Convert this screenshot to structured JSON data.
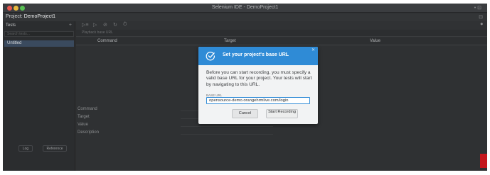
{
  "window": {
    "title": "Selenium IDE - DemoProject1",
    "right_controls": "• ⊡"
  },
  "project": {
    "label": "Project:",
    "name": "DemoProject1",
    "icons": "⊡"
  },
  "sidebar": {
    "header": "Tests",
    "add_icon": "+",
    "search_placeholder": "Search tests...",
    "items": [
      {
        "label": "Untitled"
      }
    ],
    "footer_buttons": [
      "Log",
      "Reference"
    ]
  },
  "toolbar": {
    "tools": [
      "▷≡",
      "▷",
      "⊘",
      "↻",
      "⏱"
    ],
    "record_icon": "⏺"
  },
  "url_bar": {
    "placeholder": "Playback base URL"
  },
  "table": {
    "columns": [
      "Command",
      "Target",
      "Value"
    ]
  },
  "command_editor": {
    "labels": [
      "Command",
      "Target",
      "Value",
      "Description"
    ]
  },
  "dialog": {
    "title": "Set your project's base URL",
    "close_icon": "✕",
    "body": "Before you can start recording, you must specify a valid base URL for your project. Your tests will start by navigating to this URL.",
    "field_label": "BASE URL",
    "base_url": "opensource-demo.orangehrmlive.com/login",
    "cancel_label": "Cancel",
    "start_label": "Start Recording"
  },
  "colors": {
    "accent": "#2f8bd6",
    "app_background": "#2f3133",
    "dialog_background": "#f2f3f4"
  }
}
